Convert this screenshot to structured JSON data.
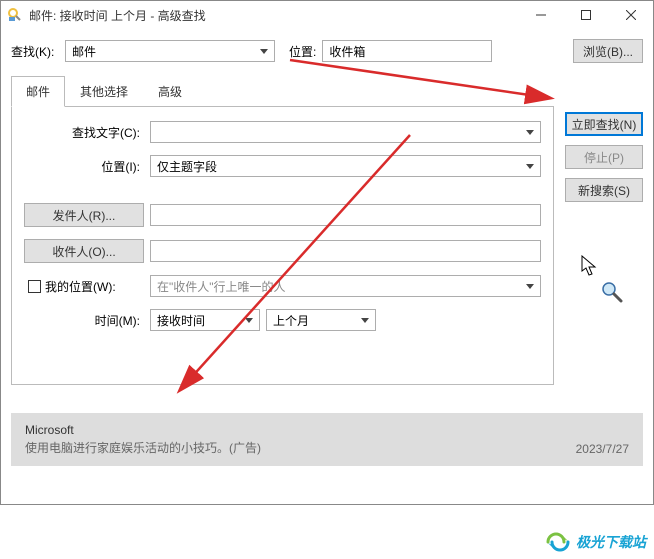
{
  "titlebar": {
    "title": "邮件: 接收时间 上个月 - 高级查找"
  },
  "row1": {
    "search_label": "查找(K):",
    "search_value": "邮件",
    "location_label": "位置:",
    "location_value": "收件箱",
    "browse_label": "浏览(B)..."
  },
  "tabs": {
    "mail": "邮件",
    "other": "其他选择",
    "advanced": "高级"
  },
  "right_buttons": {
    "find_now": "立即查找(N)",
    "stop": "停止(P)",
    "new_search": "新搜索(S)"
  },
  "form": {
    "search_text_label": "查找文字(C):",
    "location_label": "位置(I):",
    "location_value": "仅主题字段",
    "sender_label": "发件人(R)...",
    "recipient_label": "收件人(O)...",
    "my_location_label": "我的位置(W):",
    "my_location_placeholder": "在\"收件人\"行上唯一的人",
    "time_label": "时间(M):",
    "time_field": "接收时间",
    "time_range": "上个月"
  },
  "result": {
    "sender": "Microsoft",
    "subject": "使用电脑进行家庭娱乐活动的小技巧。(广告)",
    "date": "2023/7/27"
  },
  "watermark": {
    "text": "极光下载站"
  }
}
